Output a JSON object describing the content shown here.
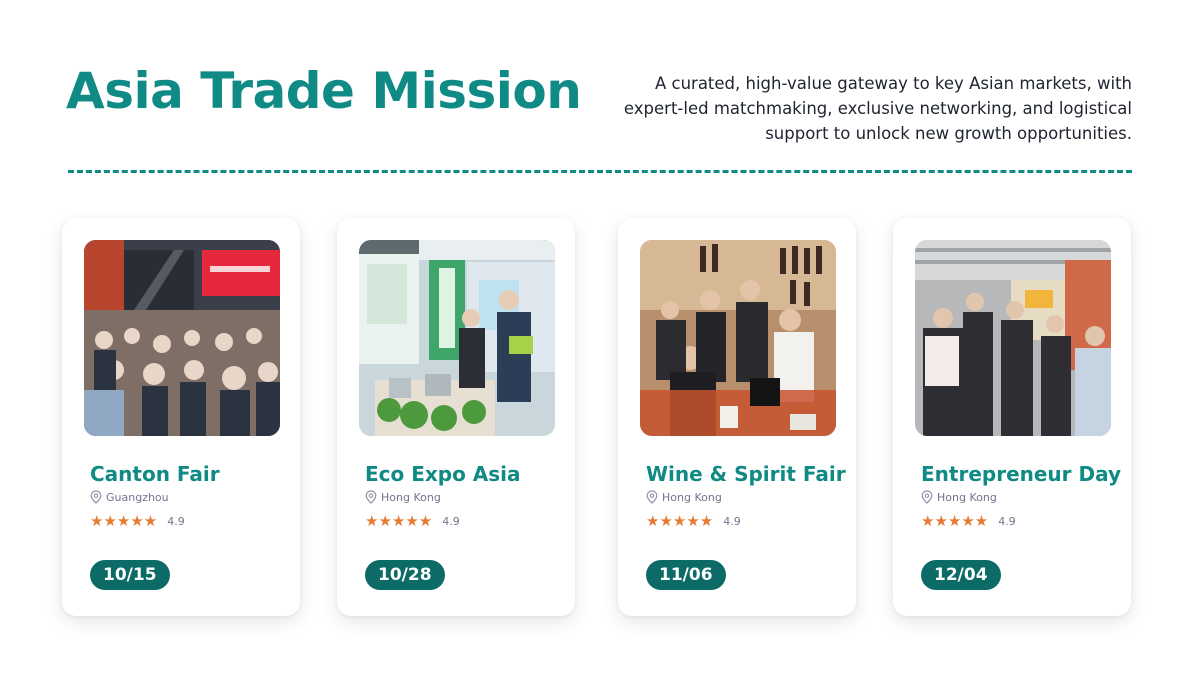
{
  "header": {
    "title": "Asia Trade Mission",
    "subtitle": "A curated, high-value gateway to key Asian markets, with expert-led matchmaking, exclusive networking, and logistical support to unlock new growth opportunities."
  },
  "colors": {
    "accent": "#0f8a84",
    "badge": "#0c6b66",
    "star": "#e57b34"
  },
  "events": [
    {
      "name": "Canton Fair",
      "location": "Guangzhou",
      "rating": "4.9",
      "stars": "★★★★★",
      "date": "10/15",
      "photo": "crowded-trade-fair-photo"
    },
    {
      "name": "Eco Expo Asia",
      "location": "Hong Kong",
      "rating": "4.9",
      "stars": "★★★★★",
      "date": "10/28",
      "photo": "eco-expo-booth-photo"
    },
    {
      "name": "Wine & Spirit Fair",
      "location": "Hong Kong",
      "rating": "4.9",
      "stars": "★★★★★",
      "date": "11/06",
      "photo": "wine-tasting-photo"
    },
    {
      "name": "Entrepreneur Day",
      "location": "Hong Kong",
      "rating": "4.9",
      "stars": "★★★★★",
      "date": "12/04",
      "photo": "entrepreneur-expo-photo"
    }
  ],
  "icons": {
    "location": "map-pin-icon",
    "rating": "star-icon"
  }
}
